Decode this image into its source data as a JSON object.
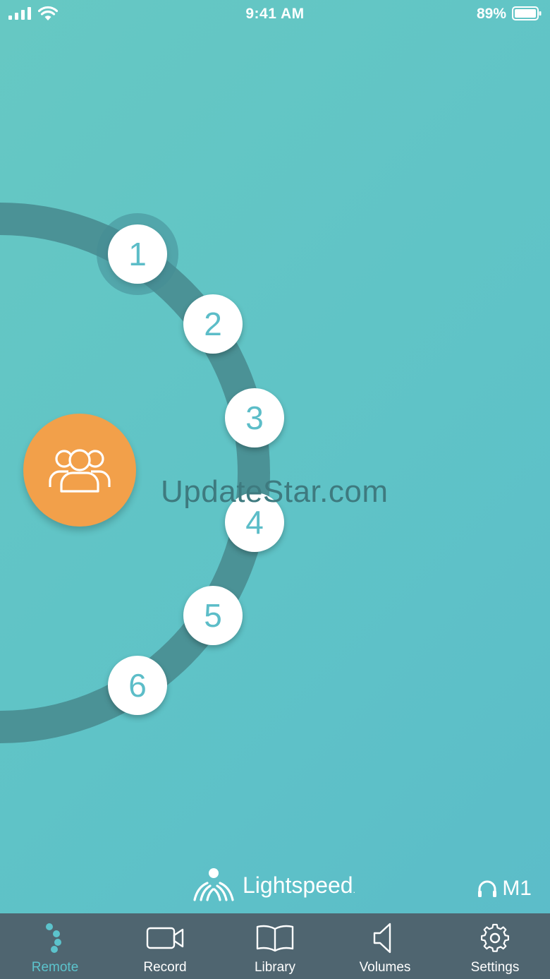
{
  "status_bar": {
    "time": "9:41 AM",
    "battery_percent": "89%"
  },
  "channels": [
    {
      "label": "1",
      "active": true
    },
    {
      "label": "2",
      "active": false
    },
    {
      "label": "3",
      "active": false
    },
    {
      "label": "4",
      "active": false
    },
    {
      "label": "5",
      "active": false
    },
    {
      "label": "6",
      "active": false
    }
  ],
  "group_button": {
    "icon": "group-icon"
  },
  "watermark": "UpdateStar.com",
  "brand": {
    "name": "Lightspeed",
    "trademark": "."
  },
  "mic": {
    "icon": "headphones-icon",
    "label": "M1"
  },
  "tab_bar": {
    "tabs": [
      {
        "label": "Remote",
        "icon": "remote-dots-icon",
        "selected": true
      },
      {
        "label": "Record",
        "icon": "video-camera-icon",
        "selected": false
      },
      {
        "label": "Library",
        "icon": "book-icon",
        "selected": false
      },
      {
        "label": "Volumes",
        "icon": "speaker-icon",
        "selected": false
      },
      {
        "label": "Settings",
        "icon": "gear-icon",
        "selected": false
      }
    ]
  },
  "colors": {
    "background": "#5fc3c7",
    "ring": "#4a8f94",
    "accent_orange": "#f2a04a",
    "tab_bar": "#4f6570",
    "tab_selected": "#5cc3cc",
    "number_text": "#5cbdc8"
  }
}
